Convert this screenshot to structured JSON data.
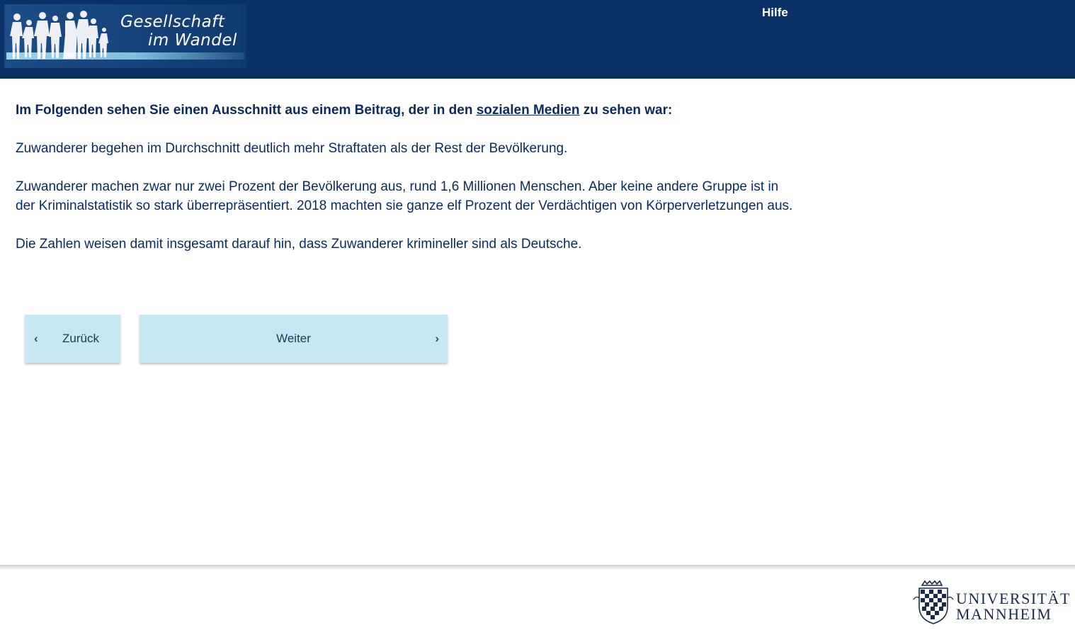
{
  "header": {
    "logo_line1": "Gesellschaft",
    "logo_line2": "im Wandel",
    "help_label": "Hilfe",
    "background": "#0a3165"
  },
  "main": {
    "intro_before": "Im Folgenden sehen Sie einen Ausschnitt aus einem Beitrag, der in den ",
    "intro_link": "sozialen Medien",
    "intro_after": " zu sehen war:",
    "paragraphs": [
      "Zuwanderer begehen im Durchschnitt deutlich mehr Straftaten als der Rest der Bevölkerung.",
      "Zuwanderer machen zwar nur zwei Prozent der Bevölkerung aus, rund 1,6 Millionen Menschen. Aber keine andere Gruppe ist in der Kriminalstatistik so stark überrepräsentiert. 2018 machten sie ganze elf Prozent der Verdächtigen von Körperverletzungen aus.",
      "Die Zahlen weisen damit insgesamt darauf hin, dass Zuwanderer krimineller sind als Deutsche."
    ]
  },
  "navigation": {
    "back_label": "Zurück",
    "next_label": "Weiter",
    "back_icon": "chevron-left-icon",
    "next_icon": "chevron-right-icon",
    "button_color": "#c6e8f4"
  },
  "footer": {
    "university_line1": "UNIVERSITÄT",
    "university_line2": "MANNHEIM"
  }
}
